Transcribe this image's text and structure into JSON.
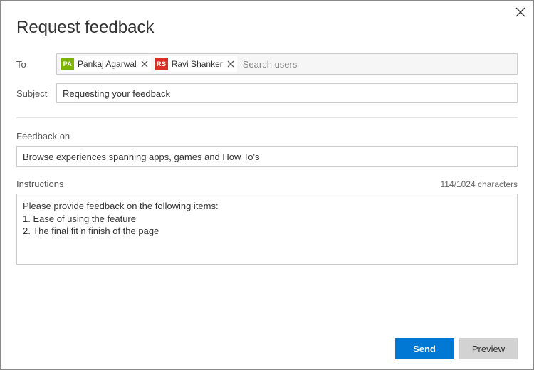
{
  "dialog": {
    "title": "Request feedback"
  },
  "to": {
    "label": "To",
    "chips": [
      {
        "initials": "PA",
        "name": "Pankaj Agarwal",
        "avatar_class": "pa"
      },
      {
        "initials": "RS",
        "name": "Ravi Shanker",
        "avatar_class": "rs"
      }
    ],
    "placeholder": "Search users"
  },
  "subject": {
    "label": "Subject",
    "value": "Requesting your feedback"
  },
  "feedback_on": {
    "label": "Feedback on",
    "value": "Browse experiences spanning apps, games and How To's"
  },
  "instructions": {
    "label": "Instructions",
    "char_count": "114/1024 characters",
    "value": "Please provide feedback on the following items:\n1. Ease of using the feature\n2. The final fit n finish of the page"
  },
  "buttons": {
    "send": "Send",
    "preview": "Preview"
  }
}
